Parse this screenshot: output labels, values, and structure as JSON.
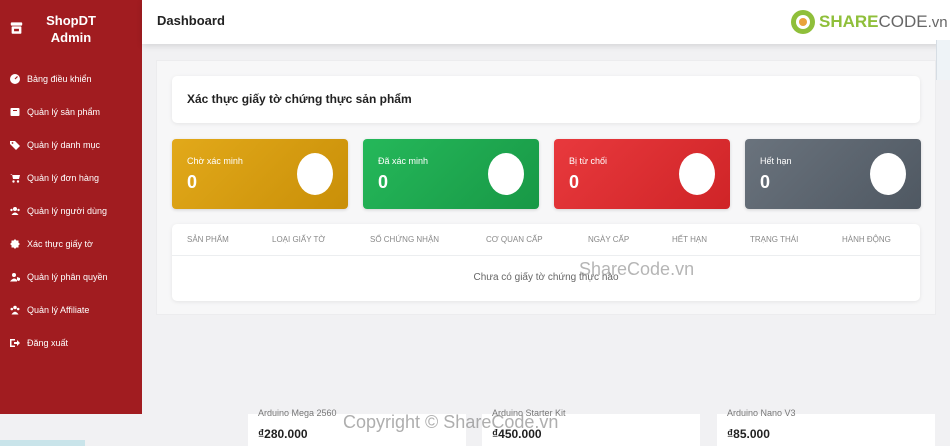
{
  "sidebar": {
    "brand_line1": "ShopDT",
    "brand_line2": "Admin",
    "items": [
      {
        "label": "Bảng điều khiển",
        "icon": "gauge-icon"
      },
      {
        "label": "Quản lý sản phẩm",
        "icon": "box-icon"
      },
      {
        "label": "Quản lý danh mục",
        "icon": "tags-icon"
      },
      {
        "label": "Quản lý đơn hàng",
        "icon": "cart-icon"
      },
      {
        "label": "Quản lý người dùng",
        "icon": "users-icon"
      },
      {
        "label": "Xác thực giấy tờ",
        "icon": "badge-check-icon"
      },
      {
        "label": "Quản lý phân quyền",
        "icon": "user-shield-icon"
      },
      {
        "label": "Quản lý Affiliate",
        "icon": "network-icon"
      },
      {
        "label": "Đăng xuất",
        "icon": "logout-icon"
      }
    ]
  },
  "header": {
    "title": "Dashboard",
    "logo_part1": "SHARE",
    "logo_part2": "CODE",
    "logo_part3": ".vn"
  },
  "main": {
    "card_title": "Xác thực giấy tờ chứng thực sản phẩm",
    "stats": [
      {
        "label": "Chờ xác minh",
        "value": "0"
      },
      {
        "label": "Đã xác minh",
        "value": "0"
      },
      {
        "label": "Bị từ chối",
        "value": "0"
      },
      {
        "label": "Hết hạn",
        "value": "0"
      }
    ],
    "columns": [
      "Sản phẩm",
      "Loại giấy tờ",
      "Số chứng nhận",
      "Cơ quan cấp",
      "Ngày cấp",
      "Hết hạn",
      "Trạng thái",
      "Hành động"
    ],
    "empty_message": "Chưa có giấy tờ chứng thực nào"
  },
  "background_products": [
    {
      "name": "Arduino Mega 2560",
      "price": "₫280.000"
    },
    {
      "name": "Arduino Starter Kit",
      "price": "₫450.000"
    },
    {
      "name": "Arduino Nano V3",
      "price": "₫85.000"
    }
  ],
  "watermarks": {
    "center": "ShareCode.vn",
    "bottom": "Copyright © ShareCode.vn"
  },
  "colors": {
    "sidebar": "#a11c20",
    "pending": "#d69d10",
    "verified": "#20aa50",
    "rejected": "#dc2e32",
    "expired": "#5a636d"
  }
}
